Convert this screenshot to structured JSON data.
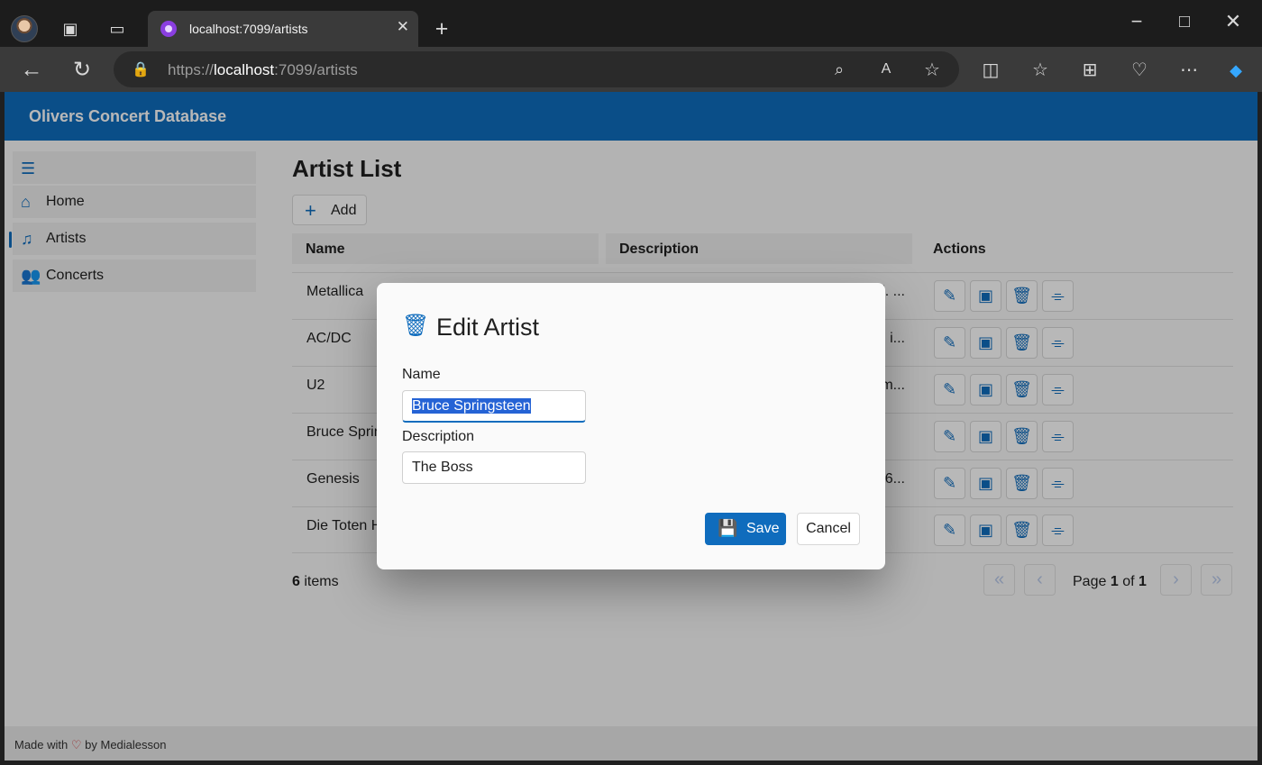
{
  "browser": {
    "tab_title": "localhost:7099/artists",
    "url_prefix": "https://",
    "url_host": "localhost",
    "url_suffix": ":7099/artists"
  },
  "app": {
    "title": "Olivers Concert Database"
  },
  "sidebar": {
    "items": [
      {
        "label": "Home",
        "icon": "home-icon"
      },
      {
        "label": "Artists",
        "icon": "artist-icon"
      },
      {
        "label": "Concerts",
        "icon": "people-icon"
      }
    ]
  },
  "main": {
    "page_title": "Artist List",
    "add_label": "Add",
    "columns": [
      "Name",
      "Description",
      "Actions"
    ],
    "rows": [
      {
        "name": "Metallica",
        "description": "d. ..."
      },
      {
        "name": "AC/DC",
        "description": "d i..."
      },
      {
        "name": "U2",
        "description": "m..."
      },
      {
        "name": "Bruce Sprin",
        "description": ""
      },
      {
        "name": "Genesis",
        "description": "6..."
      },
      {
        "name": "Die Toten H",
        "description": ""
      }
    ],
    "items_count": "6",
    "items_label": "items",
    "pager": {
      "page_label": "Page",
      "page": "1",
      "of_label": "of",
      "pages": "1"
    }
  },
  "dialog": {
    "title": "Edit Artist",
    "name_label": "Name",
    "name_value": "Bruce Springsteen",
    "description_label": "Description",
    "description_value": "The Boss",
    "save_label": "Save",
    "cancel_label": "Cancel"
  },
  "footer": {
    "made_with": "Made with",
    "heart": "♡",
    "by": "by Medialesson"
  },
  "colors": {
    "accent": "#0f6cbd",
    "header": "#0f6cbd",
    "selection": "#2563d5"
  }
}
